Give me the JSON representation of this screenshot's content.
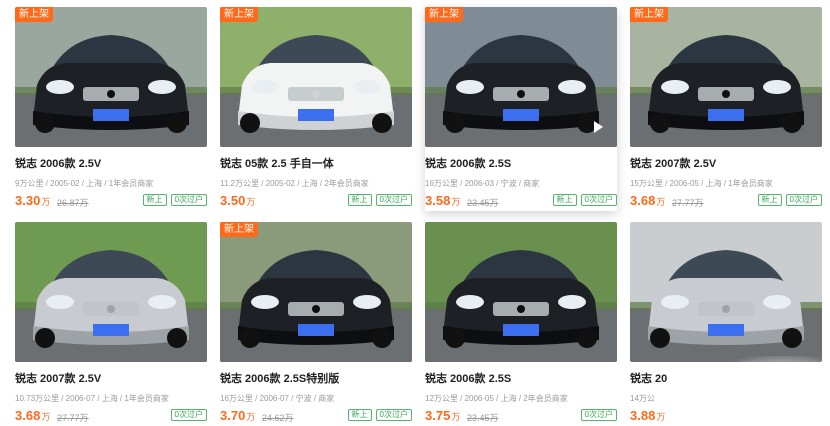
{
  "colors": {
    "accent": "#ff6a1a",
    "badge": "#3aa657"
  },
  "listings": [
    {
      "title": "锐志 2006款 2.5V",
      "meta": "9万公里 / 2005-02 / 上海 / 1年会员商家",
      "price": "3.30",
      "unit": "万",
      "orig": "26.87万",
      "new_tag": "新上架",
      "badges": [
        "新上",
        "0次过户"
      ]
    },
    {
      "title": "锐志 05款 2.5 手自一体",
      "meta": "11.2万公里 / 2005-02 / 上海 / 2年会员商家",
      "price": "3.50",
      "unit": "万",
      "orig": "",
      "new_tag": "新上架",
      "badges": [
        "新上",
        "0次过户"
      ]
    },
    {
      "title": "锐志 2006款 2.5S",
      "meta": "16万公里 / 2006-03 / 宁波 / 商家",
      "price": "3.58",
      "unit": "万",
      "orig": "23.45万",
      "new_tag": "新上架",
      "badges": [
        "新上",
        "0次过户"
      ]
    },
    {
      "title": "锐志 2007款 2.5V",
      "meta": "15万公里 / 2006-05 / 上海 / 1年会员商家",
      "price": "3.68",
      "unit": "万",
      "orig": "27.77万",
      "new_tag": "新上架",
      "badges": [
        "新上",
        "0次过户"
      ]
    },
    {
      "title": "锐志 2007款 2.5V",
      "meta": "10.73万公里 / 2006-07 / 上海 / 1年会员商家",
      "price": "3.68",
      "unit": "万",
      "orig": "27.77万",
      "new_tag": "",
      "badges": [
        "0次过户"
      ]
    },
    {
      "title": "锐志 2006款 2.5S特别版",
      "meta": "16万公里 / 2006-07 / 宁波 / 商家",
      "price": "3.70",
      "unit": "万",
      "orig": "24.62万",
      "new_tag": "新上架",
      "badges": [
        "新上",
        "0次过户"
      ]
    },
    {
      "title": "锐志 2006款 2.5S",
      "meta": "12万公里 / 2006-05 / 上海 / 2年会员商家",
      "price": "3.75",
      "unit": "万",
      "orig": "23.45万",
      "new_tag": "",
      "badges": [
        "0次过户"
      ]
    },
    {
      "title": "锐志 20",
      "meta": "14万公",
      "price": "3.88",
      "unit": "万",
      "orig": "",
      "new_tag": "",
      "badges": []
    }
  ]
}
